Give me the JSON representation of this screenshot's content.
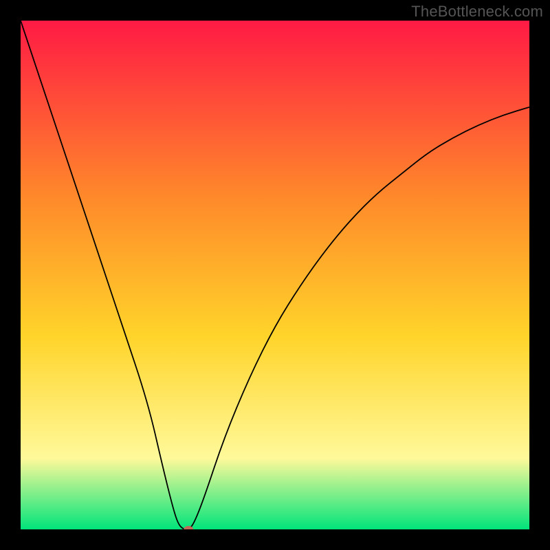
{
  "attribution": "TheBottleneck.com",
  "colors": {
    "frame": "#000000",
    "gradient_top": "#ff1a44",
    "gradient_mid_upper": "#ff8a2a",
    "gradient_mid": "#ffd42a",
    "gradient_mid_lower": "#fff99a",
    "gradient_bottom": "#00e47a",
    "curve_stroke": "#000000",
    "marker": "#c06a5a"
  },
  "chart_data": {
    "type": "line",
    "title": "",
    "xlabel": "",
    "ylabel": "",
    "xlim": [
      0,
      100
    ],
    "ylim": [
      0,
      100
    ],
    "grid": false,
    "legend": false,
    "series": [
      {
        "name": "curve",
        "x": [
          0,
          5,
          10,
          15,
          20,
          25,
          28,
          30,
          31,
          32,
          33,
          34,
          36,
          40,
          45,
          50,
          55,
          60,
          65,
          70,
          75,
          80,
          85,
          90,
          95,
          100
        ],
        "y": [
          100,
          85,
          70,
          55,
          40,
          25,
          12,
          4,
          1,
          0,
          0,
          1,
          6,
          18,
          30,
          40,
          48,
          55,
          61,
          66,
          70,
          74,
          77,
          79.5,
          81.5,
          83
        ]
      }
    ],
    "marker": {
      "x": 33,
      "y": 0
    }
  }
}
